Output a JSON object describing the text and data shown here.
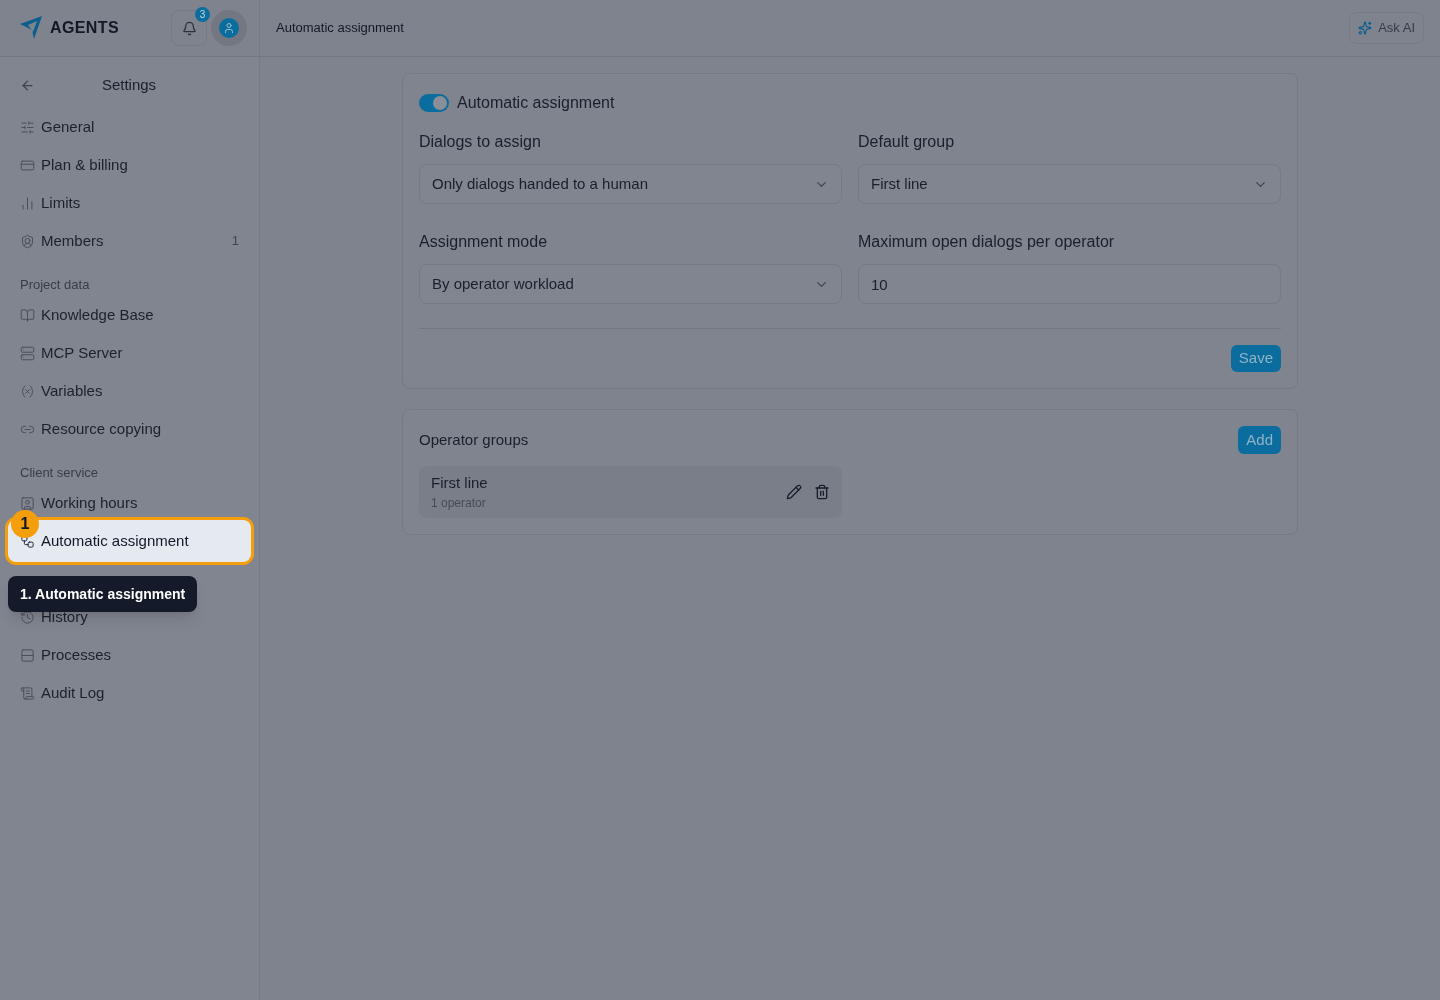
{
  "brand": {
    "name": "AGENTS"
  },
  "notifications": {
    "count": "3"
  },
  "header": {
    "breadcrumb": "Automatic assignment",
    "ask_ai": "Ask AI"
  },
  "sidebar": {
    "title": "Settings",
    "sections": [
      {
        "items": [
          {
            "label": "General",
            "selected": false
          },
          {
            "label": "Plan & billing",
            "selected": false
          },
          {
            "label": "Limits",
            "selected": false
          },
          {
            "label": "Members",
            "count": "1",
            "selected": false
          }
        ]
      },
      {
        "heading": "Project data",
        "items": [
          {
            "label": "Knowledge Base",
            "selected": false
          },
          {
            "label": "MCP Server",
            "selected": false
          },
          {
            "label": "Variables",
            "selected": false
          },
          {
            "label": "Resource copying",
            "selected": false
          }
        ]
      },
      {
        "heading": "Client service",
        "items": [
          {
            "label": "Working hours",
            "selected": false
          },
          {
            "label": "Automatic assignment",
            "selected": true
          },
          {
            "label": "History",
            "selected": false
          },
          {
            "label": "Processes",
            "selected": false
          },
          {
            "label": "Audit Log",
            "selected": false
          }
        ]
      }
    ]
  },
  "tour": {
    "step": "1",
    "tooltip": "1. Automatic assignment"
  },
  "settings_card": {
    "toggle": {
      "label": "Automatic assignment",
      "on": true
    },
    "fields": [
      {
        "label": "Dialogs to assign",
        "kind": "select",
        "value": "Only dialogs handed to a human"
      },
      {
        "label": "Default group",
        "kind": "select",
        "value": "First line"
      },
      {
        "label": "Assignment mode",
        "kind": "select",
        "value": "By operator workload"
      },
      {
        "label": "Maximum open dialogs per operator",
        "kind": "input",
        "value": "10"
      }
    ],
    "save": "Save"
  },
  "groups_card": {
    "title": "Operator groups",
    "add": "Add",
    "groups": [
      {
        "name": "First line",
        "subtitle": "1 operator"
      }
    ]
  }
}
